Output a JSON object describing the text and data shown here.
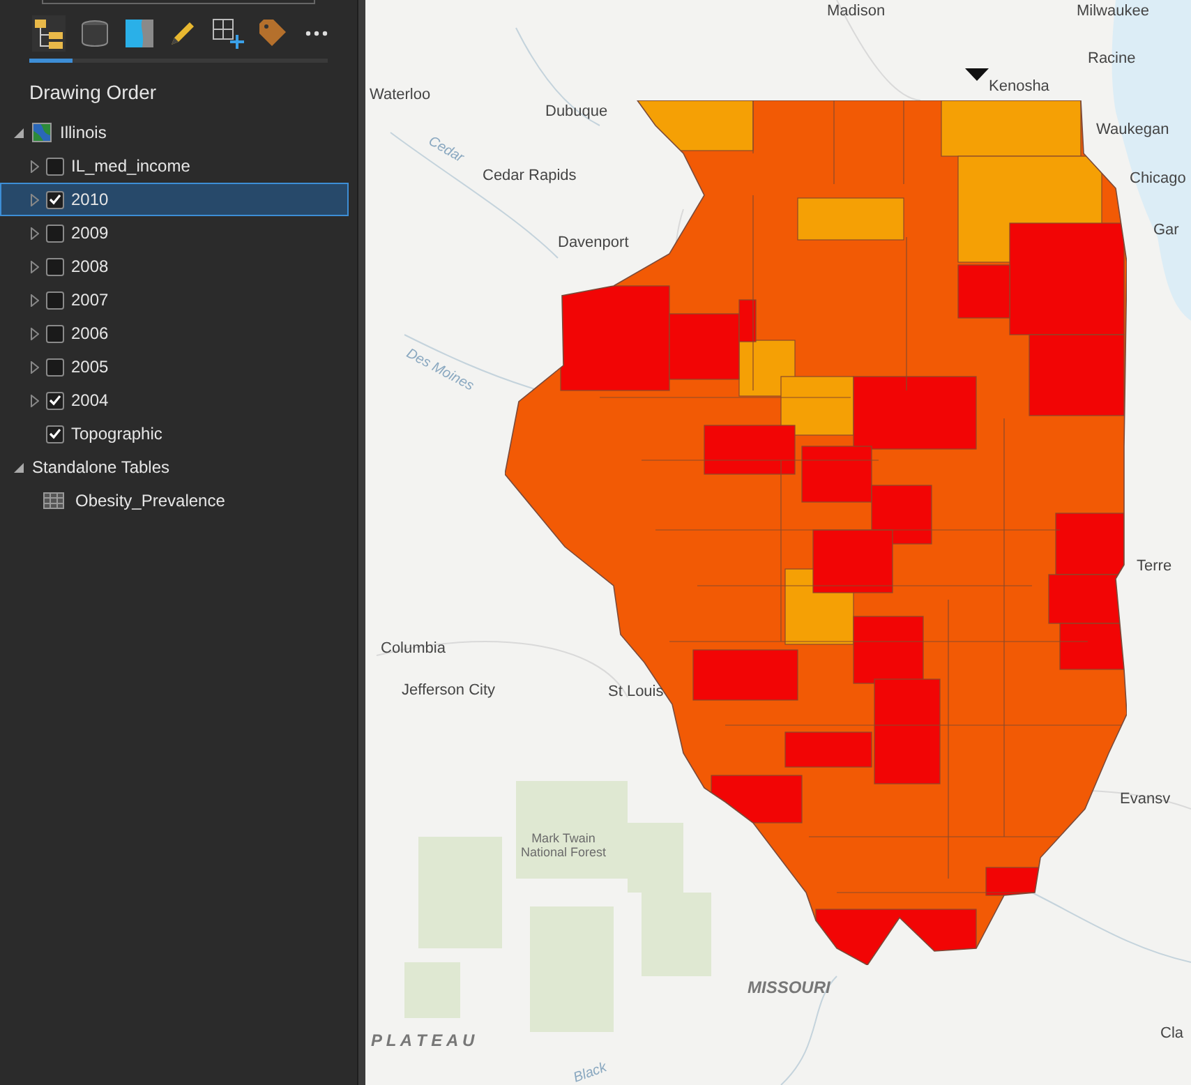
{
  "contents_tabs": [
    {
      "kind": "drawing-order",
      "selected": true
    },
    {
      "kind": "source",
      "selected": false
    },
    {
      "kind": "selection",
      "selected": false
    },
    {
      "kind": "editing",
      "selected": false
    },
    {
      "kind": "snapping",
      "selected": false
    },
    {
      "kind": "labeling",
      "selected": false
    },
    {
      "kind": "more",
      "selected": false
    }
  ],
  "contents_title": "Drawing Order",
  "tree": [
    {
      "label": "Illinois",
      "kind": "map",
      "expanded": true,
      "children": [
        {
          "label": "IL_med_income",
          "kind": "layer",
          "checked": false,
          "selected": false
        },
        {
          "label": "2010",
          "kind": "layer",
          "checked": true,
          "selected": true
        },
        {
          "label": "2009",
          "kind": "layer",
          "checked": false,
          "selected": false
        },
        {
          "label": "2008",
          "kind": "layer",
          "checked": false,
          "selected": false
        },
        {
          "label": "2007",
          "kind": "layer",
          "checked": false,
          "selected": false
        },
        {
          "label": "2006",
          "kind": "layer",
          "checked": false,
          "selected": false
        },
        {
          "label": "2005",
          "kind": "layer",
          "checked": false,
          "selected": false
        },
        {
          "label": "2004",
          "kind": "layer",
          "checked": true,
          "selected": false
        },
        {
          "label": "Topographic",
          "kind": "basemap",
          "checked": true,
          "selected": false
        }
      ]
    },
    {
      "label": "Standalone Tables",
      "kind": "group",
      "expanded": true,
      "children": [
        {
          "label": "Obesity_Prevalence",
          "kind": "table"
        }
      ]
    }
  ],
  "map": {
    "labels": [
      {
        "text": "Madison",
        "kind": "city"
      },
      {
        "text": "Milwaukee",
        "kind": "city"
      },
      {
        "text": "Waterloo",
        "kind": "city"
      },
      {
        "text": "Dubuque",
        "kind": "city"
      },
      {
        "text": "Kenosha",
        "kind": "city"
      },
      {
        "text": "Racine",
        "kind": "city"
      },
      {
        "text": "Waukegan",
        "kind": "city"
      },
      {
        "text": "Cedar",
        "kind": "river"
      },
      {
        "text": "Cedar Rapids",
        "kind": "city"
      },
      {
        "text": "Chicago",
        "kind": "city"
      },
      {
        "text": "Gar",
        "kind": "city"
      },
      {
        "text": "Davenport",
        "kind": "city"
      },
      {
        "text": "Des Moines",
        "kind": "river"
      },
      {
        "text": "Terre",
        "kind": "city"
      },
      {
        "text": "Columbia",
        "kind": "city"
      },
      {
        "text": "Jefferson City",
        "kind": "city"
      },
      {
        "text": "St Louis",
        "kind": "city"
      },
      {
        "text": "Evansv",
        "kind": "city"
      },
      {
        "text": "Mark Twain National Forest",
        "kind": "park"
      },
      {
        "text": "MISSOURI",
        "kind": "region"
      },
      {
        "text": "P L A T E A U",
        "kind": "region"
      },
      {
        "text": "Black",
        "kind": "river"
      },
      {
        "text": "Cla",
        "kind": "city"
      }
    ]
  }
}
